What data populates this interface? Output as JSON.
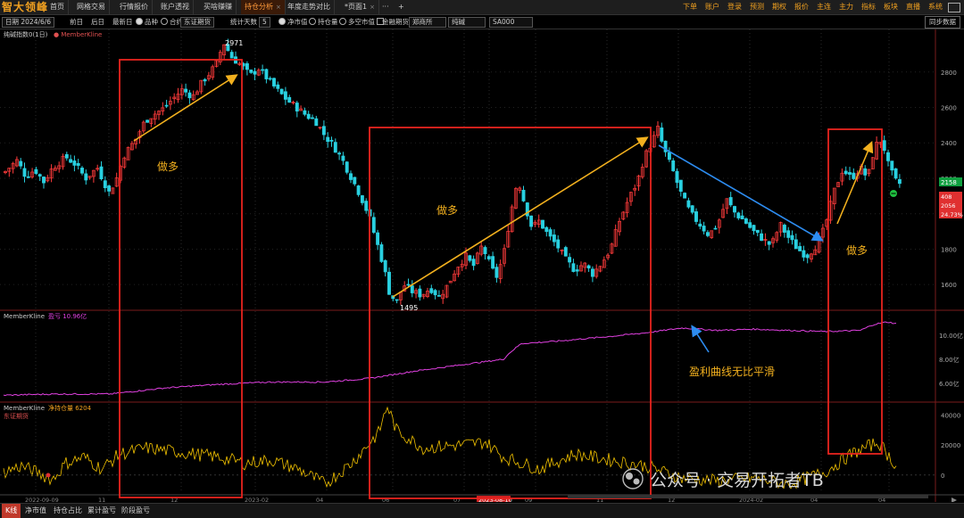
{
  "app": {
    "logo": "智大领峰"
  },
  "top_tabs": [
    {
      "label": "首页",
      "active": false,
      "closable": false
    },
    {
      "label": "网格交易",
      "active": false,
      "closable": false
    },
    {
      "label": "行情报价",
      "active": false,
      "closable": false
    },
    {
      "label": "账户透视",
      "active": false,
      "closable": false
    },
    {
      "label": "买啥赚赚",
      "active": false,
      "closable": false
    },
    {
      "label": "持仓分析",
      "active": true,
      "closable": true
    },
    {
      "label": "年度走势对比",
      "active": false,
      "closable": false
    },
    {
      "label": "*页面1",
      "active": false,
      "closable": true
    }
  ],
  "top_tab_extras": {
    "more": "···",
    "add": "+"
  },
  "right_menu": [
    "下单",
    "账户",
    "登录",
    "预测",
    "期权",
    "报价",
    "主连",
    "主力",
    "指标",
    "板块",
    "直播",
    "系统"
  ],
  "toolbar": {
    "date_label": "日期 2024/6/6",
    "prev": "前日",
    "next": "后日",
    "latest": "最新日",
    "variety_label": "品种",
    "contract_label": "合约",
    "broker_value": "东证期货",
    "days_label": "统计天数",
    "days_value": "5",
    "net_label": "净市值",
    "holding_label": "持仓量",
    "longshort_label": "多空市值",
    "fin_label": "金融期货",
    "exchange_value": "郑商所",
    "product_value": "纯碱",
    "code_value": "SA000",
    "sync_button": "同步数据"
  },
  "panels": {
    "kline_title": "纯碱指数0(1日)",
    "kline_legend": "MemberKline",
    "profit_title": "MemberKline",
    "profit_label": "盈亏 10.96亿",
    "position_title": "MemberKline",
    "position_label": "净持仓量 6204",
    "position_member": "东证期货"
  },
  "annotations": {
    "long1": "做多",
    "long2": "做多",
    "long3": "做多",
    "smooth_curve": "盈利曲线无比平滑",
    "watermark": "公众号 · 交易开拓者TB"
  },
  "price_labels": {
    "last_price": "2158",
    "badge_top": "408",
    "badge_mid": "2056",
    "badge_pct": "24.73%"
  },
  "bottom_tabs": [
    {
      "label": "K线",
      "active": true
    },
    {
      "label": "净市值",
      "active": false
    },
    {
      "label": "持仓占比",
      "active": false
    },
    {
      "label": "累计盈亏",
      "active": false
    },
    {
      "label": "阶段盈亏",
      "active": false
    }
  ],
  "colors": {
    "up": "#ff3b3b",
    "down": "#29d0e0",
    "box": "#e8231e",
    "long_arrow": "#f2b01e",
    "short_arrow": "#2d8cf0",
    "profit_line": "#e040e0",
    "position_line": "#f2c200",
    "accent": "#f0a020"
  },
  "chart_data": [
    {
      "type": "candlestick",
      "title": "纯碱指数0(1日)",
      "y_ticks": [
        1600,
        1800,
        2000,
        2200,
        2400,
        2600,
        2800
      ],
      "ylim": [
        1460,
        2990
      ],
      "x_ticks": [
        "2022-09-09",
        "11",
        "12",
        "2023-02",
        "04",
        "06",
        "07",
        "2023-08-10",
        "09",
        "11",
        "12",
        "2024-02",
        "04",
        "04"
      ],
      "annotations": [
        {
          "text": "2971",
          "value": 2971
        },
        {
          "text": "1495",
          "value": 1495
        }
      ],
      "close_path": [
        [
          0,
          2230
        ],
        [
          15,
          2300
        ],
        [
          25,
          2210
        ],
        [
          35,
          2250
        ],
        [
          45,
          2180
        ],
        [
          55,
          2260
        ],
        [
          70,
          2320
        ],
        [
          80,
          2280
        ],
        [
          92,
          2200
        ],
        [
          105,
          2260
        ],
        [
          118,
          2120
        ],
        [
          126,
          2190
        ],
        [
          135,
          2330
        ],
        [
          148,
          2420
        ],
        [
          158,
          2520
        ],
        [
          168,
          2560
        ],
        [
          178,
          2590
        ],
        [
          190,
          2650
        ],
        [
          200,
          2700
        ],
        [
          212,
          2660
        ],
        [
          222,
          2740
        ],
        [
          232,
          2800
        ],
        [
          240,
          2860
        ],
        [
          246,
          2971
        ],
        [
          256,
          2880
        ],
        [
          266,
          2840
        ],
        [
          276,
          2780
        ],
        [
          286,
          2820
        ],
        [
          296,
          2760
        ],
        [
          306,
          2700
        ],
        [
          318,
          2640
        ],
        [
          328,
          2600
        ],
        [
          338,
          2560
        ],
        [
          350,
          2520
        ],
        [
          360,
          2440
        ],
        [
          370,
          2380
        ],
        [
          380,
          2300
        ],
        [
          390,
          2200
        ],
        [
          400,
          2100
        ],
        [
          410,
          1980
        ],
        [
          418,
          1840
        ],
        [
          426,
          1700
        ],
        [
          432,
          1560
        ],
        [
          440,
          1495
        ],
        [
          448,
          1600
        ],
        [
          458,
          1560
        ],
        [
          468,
          1540
        ],
        [
          478,
          1580
        ],
        [
          488,
          1530
        ],
        [
          498,
          1600
        ],
        [
          508,
          1700
        ],
        [
          518,
          1760
        ],
        [
          526,
          1700
        ],
        [
          536,
          1820
        ],
        [
          546,
          1700
        ],
        [
          552,
          1640
        ],
        [
          560,
          1760
        ],
        [
          568,
          2000
        ],
        [
          576,
          2200
        ],
        [
          584,
          2050
        ],
        [
          592,
          1920
        ],
        [
          600,
          1960
        ],
        [
          610,
          1880
        ],
        [
          620,
          1820
        ],
        [
          630,
          1740
        ],
        [
          640,
          1680
        ],
        [
          650,
          1720
        ],
        [
          660,
          1660
        ],
        [
          670,
          1720
        ],
        [
          680,
          1800
        ],
        [
          690,
          1960
        ],
        [
          700,
          2080
        ],
        [
          710,
          2180
        ],
        [
          718,
          2320
        ],
        [
          726,
          2400
        ],
        [
          733,
          2480
        ],
        [
          740,
          2360
        ],
        [
          750,
          2240
        ],
        [
          760,
          2100
        ],
        [
          770,
          2000
        ],
        [
          780,
          1940
        ],
        [
          790,
          1880
        ],
        [
          800,
          1940
        ],
        [
          810,
          2080
        ],
        [
          820,
          2000
        ],
        [
          830,
          1960
        ],
        [
          840,
          1900
        ],
        [
          850,
          1860
        ],
        [
          860,
          1820
        ],
        [
          870,
          1940
        ],
        [
          880,
          1860
        ],
        [
          890,
          1800
        ],
        [
          900,
          1760
        ],
        [
          910,
          1820
        ],
        [
          920,
          1920
        ],
        [
          930,
          2120
        ],
        [
          940,
          2250
        ],
        [
          950,
          2200
        ],
        [
          960,
          2260
        ],
        [
          968,
          2200
        ],
        [
          976,
          2380
        ],
        [
          984,
          2420
        ],
        [
          992,
          2260
        ],
        [
          1000,
          2180
        ],
        [
          1004,
          2170
        ]
      ]
    },
    {
      "type": "line",
      "title": "MemberKline",
      "series_label": "盈亏 10.96亿",
      "y_ticks": [
        6,
        8,
        10
      ],
      "y_tick_labels": [
        "6.00亿",
        "8.00亿",
        "10.00亿"
      ],
      "ylim": [
        4.5,
        12
      ],
      "path": [
        [
          0,
          5.0
        ],
        [
          60,
          5.1
        ],
        [
          120,
          5.1
        ],
        [
          180,
          5.6
        ],
        [
          240,
          5.9
        ],
        [
          300,
          6.1
        ],
        [
          360,
          6.1
        ],
        [
          410,
          6.4
        ],
        [
          460,
          7.0
        ],
        [
          520,
          7.6
        ],
        [
          560,
          8.0
        ],
        [
          568,
          8.6
        ],
        [
          580,
          9.3
        ],
        [
          620,
          9.5
        ],
        [
          680,
          9.9
        ],
        [
          720,
          10.2
        ],
        [
          760,
          10.6
        ],
        [
          800,
          10.4
        ],
        [
          840,
          10.5
        ],
        [
          880,
          10.4
        ],
        [
          920,
          10.3
        ],
        [
          960,
          10.4
        ],
        [
          975,
          10.9
        ],
        [
          990,
          11.1
        ],
        [
          1000,
          10.96
        ]
      ]
    },
    {
      "type": "line",
      "title": "MemberKline",
      "series_label": "净持仓量 6204",
      "y_ticks": [
        0,
        20000,
        40000
      ],
      "y_tick_labels": [
        "0",
        "20000",
        "40000"
      ],
      "ylim": [
        -12000,
        48000
      ],
      "path": [
        [
          0,
          2000
        ],
        [
          20,
          6000
        ],
        [
          40,
          1000
        ],
        [
          55,
          -3000
        ],
        [
          70,
          8000
        ],
        [
          90,
          12000
        ],
        [
          110,
          4000
        ],
        [
          130,
          14000
        ],
        [
          160,
          18000
        ],
        [
          200,
          15000
        ],
        [
          240,
          12000
        ],
        [
          270,
          8000
        ],
        [
          300,
          10000
        ],
        [
          330,
          4000
        ],
        [
          360,
          -6000
        ],
        [
          390,
          8000
        ],
        [
          420,
          28000
        ],
        [
          430,
          46000
        ],
        [
          440,
          30000
        ],
        [
          470,
          18000
        ],
        [
          510,
          20000
        ],
        [
          540,
          22000
        ],
        [
          560,
          12000
        ],
        [
          600,
          4000
        ],
        [
          640,
          14000
        ],
        [
          680,
          10000
        ],
        [
          720,
          6000
        ],
        [
          760,
          -2000
        ],
        [
          800,
          -4000
        ],
        [
          840,
          -2000
        ],
        [
          880,
          -6000
        ],
        [
          920,
          2000
        ],
        [
          950,
          14000
        ],
        [
          980,
          22000
        ],
        [
          1000,
          6204
        ]
      ]
    }
  ]
}
